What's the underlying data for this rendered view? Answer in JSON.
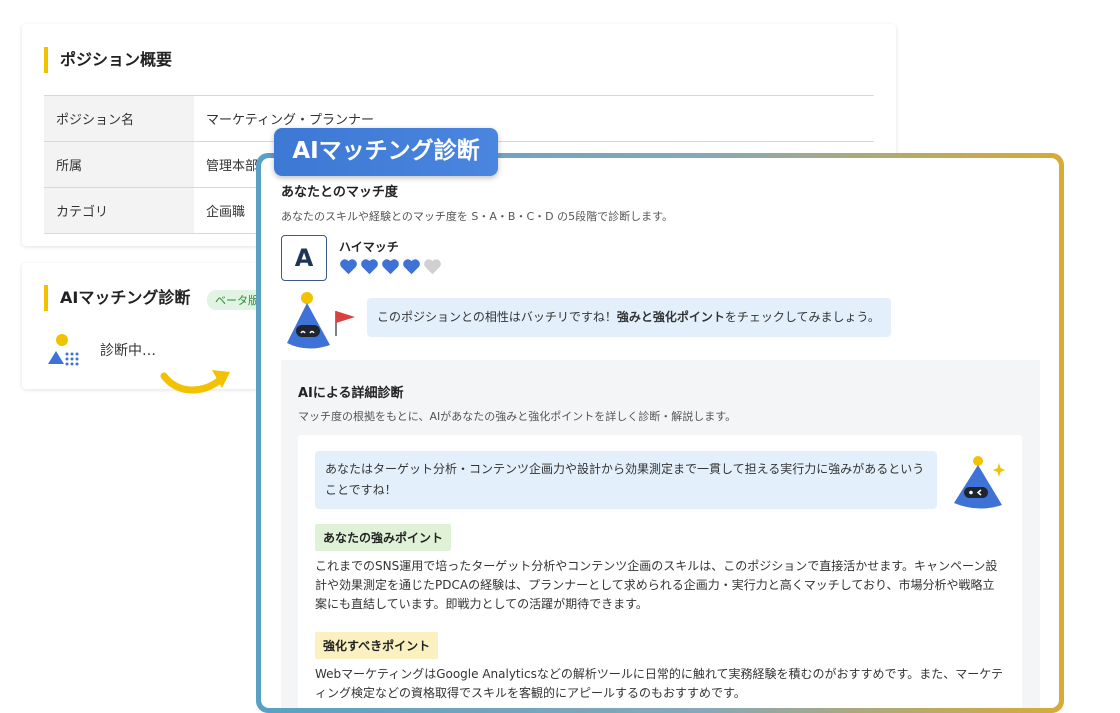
{
  "summary": {
    "title": "ポジション概要",
    "rows": [
      {
        "label": "ポジション名",
        "value": "マーケティング・プランナー"
      },
      {
        "label": "所属",
        "value": "管理本部"
      },
      {
        "label": "カテゴリ",
        "value": "企画職"
      }
    ]
  },
  "matching_card": {
    "title": "AIマッチング診断",
    "beta": "ベータ版",
    "status": "診断中…"
  },
  "ai_panel": {
    "badge": "AIマッチング診断",
    "match": {
      "title": "あなたとのマッチ度",
      "description": "あなたのスキルや経験とのマッチ度を S・A・B・C・D の5段階で診断します。",
      "grade": "A",
      "level_label": "ハイマッチ",
      "hearts_filled": 4,
      "hearts_total": 5
    },
    "comment": {
      "text_before": "このポジションとの相性はバッチリですね！",
      "text_bold": "強みと強化ポイント",
      "text_after": "をチェックしてみましょう。"
    },
    "detail": {
      "title": "AIによる詳細診断",
      "description": "マッチ度の根拠をもとに、AIがあなたの強みと強化ポイントを詳しく診断・解説します。",
      "bubble": "あなたはターゲット分析・コンテンツ企画力や設計から効果測定まで一貫して担える実行力に強みがあるということですね！",
      "strength_label": "あなたの強みポイント",
      "strength_text": "これまでのSNS運用で培ったターゲット分析やコンテンツ企画のスキルは、このポジションで直接活かせます。キャンペーン設計や効果測定を通じたPDCAの経験は、プランナーとして求められる企画力・実行力と高くマッチしており、市場分析や戦略立案にも直結しています。即戦力としての活躍が期待できます。",
      "improve_label": "強化すべきポイント",
      "improve_text": "WebマーケティングはGoogle Analyticsなどの解析ツールに日常的に触れて実務経験を積むのがおすすめです。また、マーケティング検定などの資格取得でスキルを客観的にアピールするのもおすすめです。"
    }
  },
  "colors": {
    "accent_yellow": "#f2c200",
    "badge_blue": "#3d79d4",
    "heart_blue": "#3f72d6",
    "heart_gray": "#d0d0d0",
    "strength_bg": "#dff2d8",
    "improve_bg": "#fbf1c0"
  },
  "icons": [
    "ai-robot-icon",
    "flag-icon",
    "heart-icon",
    "arrow-icon",
    "person-icon",
    "sparkle-icon"
  ]
}
